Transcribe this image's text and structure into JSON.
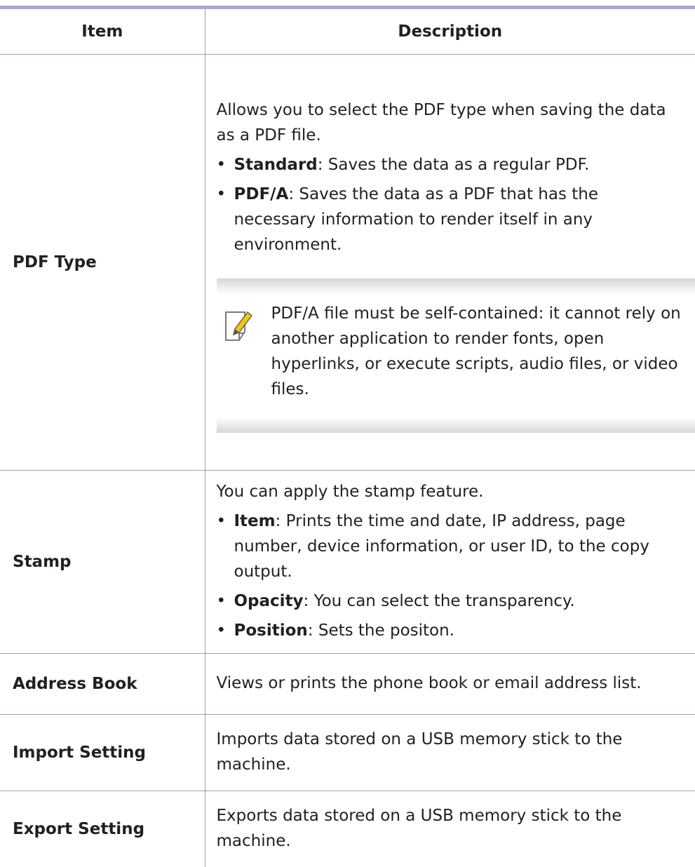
{
  "table": {
    "headers": {
      "item": "Item",
      "description": "Description"
    },
    "pdf_type": {
      "item": "PDF Type",
      "intro": "Allows you to select the PDF type when saving the data as a PDF file.",
      "bullets": [
        {
          "term": "Standard",
          "text": ": Saves the data as a regular PDF."
        },
        {
          "term": "PDF/A",
          "text": ": Saves the data as a PDF that has the necessary information to render itself in any environment."
        }
      ],
      "note": {
        "icon": "note-pencil-icon",
        "text": "PDF/A file must be self-contained: it cannot rely on another application to render fonts, open hyperlinks, or execute scripts, audio files, or video files."
      }
    },
    "stamp": {
      "item": "Stamp",
      "intro": "You can apply the stamp feature.",
      "bullets": [
        {
          "term": "Item",
          "text": ": Prints the time and date, IP address, page number, device information, or user ID, to the copy output."
        },
        {
          "term": "Opacity",
          "text": ": You can select the transparency."
        },
        {
          "term": "Position",
          "text": ": Sets the positon."
        }
      ]
    },
    "address_book": {
      "item": "Address Book",
      "description": "Views or prints the phone book or email address list."
    },
    "import_setting": {
      "item": "Import Setting",
      "description": "Imports data stored on a USB memory stick to the machine."
    },
    "export_setting": {
      "item": "Export Setting",
      "description": "Exports data stored on a USB memory stick to the machine."
    }
  },
  "bullet_glyph": "•",
  "colors": {
    "header_rule": "#a9a8cf",
    "grid_line": "#9e9cc4",
    "text": "#231f20"
  }
}
